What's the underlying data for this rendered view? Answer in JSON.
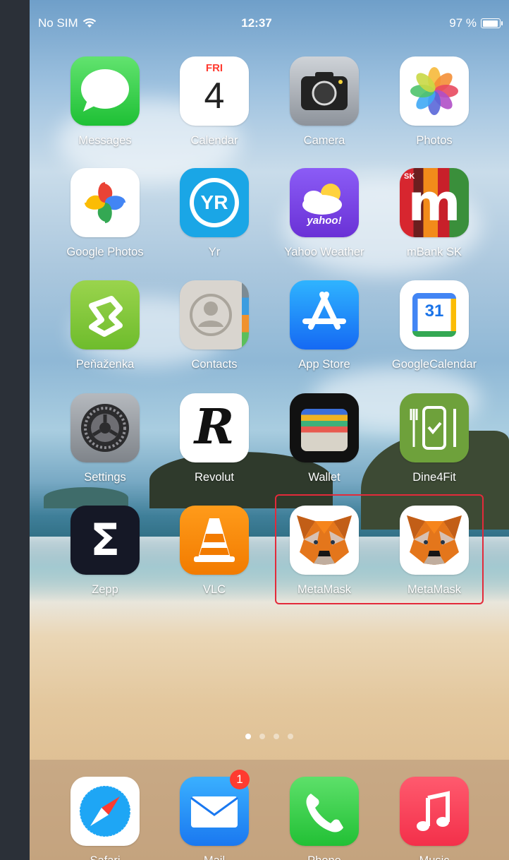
{
  "status_bar": {
    "carrier": "No SIM",
    "time": "12:37",
    "battery": "97 %"
  },
  "calendar_icon": {
    "weekday": "FRI",
    "day": "4"
  },
  "apps": {
    "messages": "Messages",
    "calendar": "Calendar",
    "camera": "Camera",
    "photos": "Photos",
    "google_photos": "Google Photos",
    "yr": "Yr",
    "yahoo_weather": "Yahoo Weather",
    "mbank": "mBank SK",
    "penazenka": "Peňaženka",
    "contacts": "Contacts",
    "app_store": "App Store",
    "google_calendar": "GoogleCalendar",
    "settings": "Settings",
    "revolut": "Revolut",
    "wallet": "Wallet",
    "dine4fit": "Dine4Fit",
    "zepp": "Zepp",
    "vlc": "VLC",
    "metamask_1": "MetaMask",
    "metamask_2": "MetaMask"
  },
  "icon_text": {
    "yr": "YR",
    "yahoo": "yahoo!",
    "mbank": "m",
    "mbank_small": "SK",
    "google_calendar_day": "31",
    "revolut": "R",
    "zepp": "Σ"
  },
  "dock": {
    "apps": [
      "Safari",
      "Mail",
      "Phone",
      "Music"
    ],
    "mail_badge": "1"
  },
  "page_dots": {
    "count": 4,
    "active_index": 1
  },
  "colors": {
    "highlight": "#e32a3a",
    "badge": "#ff3b30"
  }
}
